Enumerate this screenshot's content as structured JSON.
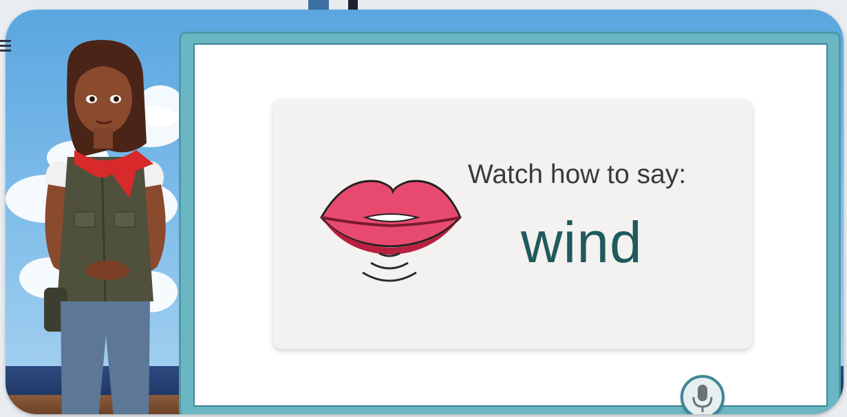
{
  "lesson": {
    "prompt": "Watch how to say:",
    "word": "wind"
  },
  "icons": {
    "lips": "lips-speaking-icon",
    "sound_waves": "sound-waves-icon",
    "microphone": "microphone-icon"
  },
  "colors": {
    "board_frame": "#6bb6c3",
    "card_background": "#f3f2f0",
    "word_color": "#1f5a5e",
    "lips_color": "#e84a6f"
  }
}
